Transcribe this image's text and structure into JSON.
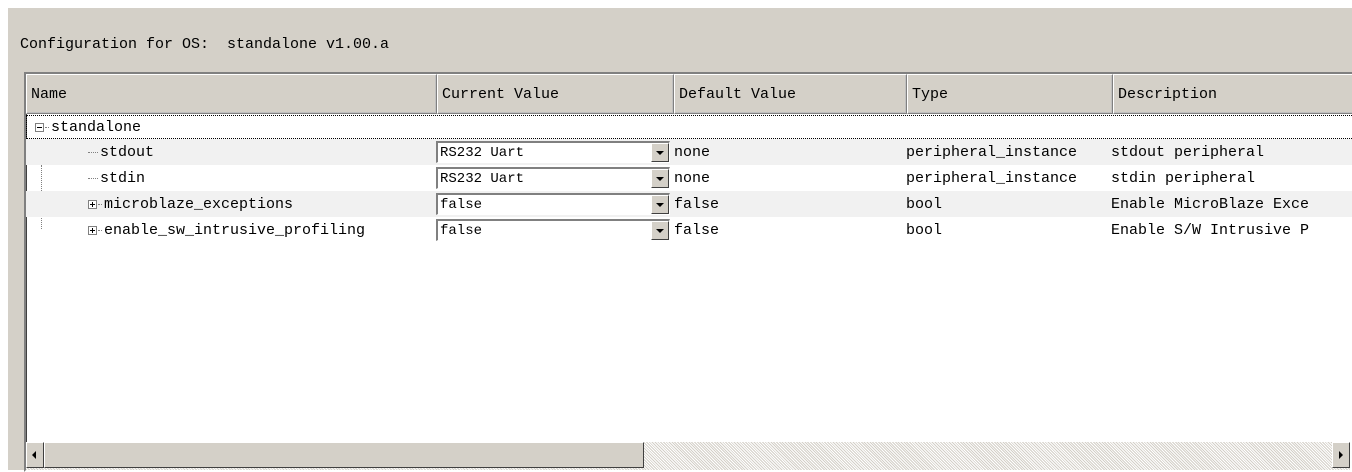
{
  "config": {
    "title": "Configuration for OS:  standalone v1.00.a"
  },
  "table": {
    "columns": [
      "Name",
      "Current Value",
      "Default Value",
      "Type",
      "Description"
    ],
    "root": {
      "name": "standalone",
      "expanded": true
    },
    "rows": [
      {
        "name": "stdout",
        "current": "RS232 Uart",
        "default": "none",
        "type": "peripheral_instance",
        "description": "stdout peripheral"
      },
      {
        "name": "stdin",
        "current": "RS232 Uart",
        "default": "none",
        "type": "peripheral_instance",
        "description": "stdin peripheral"
      },
      {
        "name": "microblaze_exceptions",
        "current": "false",
        "default": "false",
        "type": "bool",
        "description": "Enable MicroBlaze Exce"
      },
      {
        "name": "enable_sw_intrusive_profiling",
        "current": "false",
        "default": "false",
        "type": "bool",
        "description": "Enable S/W Intrusive P"
      }
    ]
  },
  "scrollbar": {
    "position": 0.0
  },
  "icons": {
    "expand": "plus-box-icon",
    "collapse": "minus-box-icon",
    "dropdown": "dropdown-arrow-icon",
    "scroll_left": "scroll-left-icon",
    "scroll_right": "scroll-right-icon"
  }
}
